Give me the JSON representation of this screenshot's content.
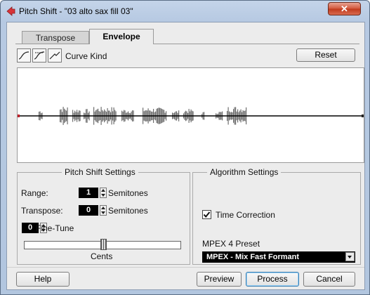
{
  "window": {
    "title": "Pitch Shift - \"03 alto sax fill 03\"",
    "close_label": "✕"
  },
  "tabs": [
    {
      "label": "Transpose",
      "active": false
    },
    {
      "label": "Envelope",
      "active": true
    }
  ],
  "toolbar": {
    "curve_kind_label": "Curve Kind",
    "reset_label": "Reset"
  },
  "pitch_shift_settings": {
    "title": "Pitch Shift Settings",
    "range_label": "Range:",
    "range_value": "1",
    "range_unit": "Semitones",
    "transpose_label": "Transpose:",
    "transpose_value": "0",
    "transpose_unit": "Semitones",
    "finetune_value": "0",
    "finetune_label": "Fine-Tune",
    "cents_label": "Cents",
    "cents_slider_position": 0.5
  },
  "algorithm_settings": {
    "title": "Algorithm Settings",
    "time_correction_label": "Time Correction",
    "time_correction_checked": true,
    "preset_label": "MPEX 4 Preset",
    "preset_value": "MPEX - Mix Fast Formant"
  },
  "buttons": {
    "help": "Help",
    "preview": "Preview",
    "process": "Process",
    "cancel": "Cancel"
  },
  "colors": {
    "titlebar": "#b9cce4",
    "waveform": "#6e6e6e",
    "envelope_line": "#000000",
    "close_button": "#c9452a"
  }
}
